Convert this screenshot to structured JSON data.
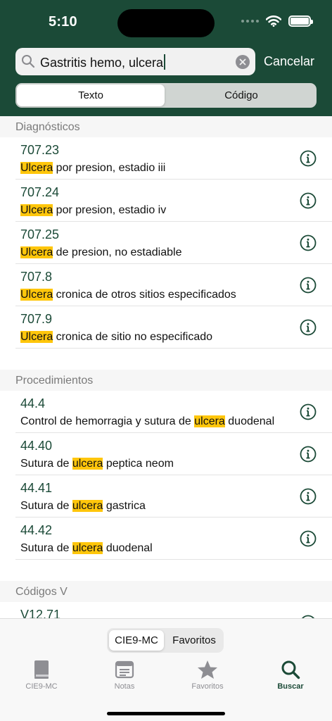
{
  "status": {
    "time": "5:10"
  },
  "search": {
    "query": "Gastritis hemo, ulcera",
    "cancel_label": "Cancelar"
  },
  "segment": {
    "options": [
      "Texto",
      "Código"
    ],
    "selected": "Texto"
  },
  "sections": [
    {
      "title": "Diagnósticos",
      "rows": [
        {
          "code": "707.23",
          "pre": "",
          "hl": "Ulcera",
          "post": " por presion, estadio iii"
        },
        {
          "code": "707.24",
          "pre": "",
          "hl": "Ulcera",
          "post": " por presion, estadio iv"
        },
        {
          "code": "707.25",
          "pre": "",
          "hl": "Ulcera",
          "post": " de presion, no estadiable"
        },
        {
          "code": "707.8",
          "pre": "",
          "hl": "Ulcera",
          "post": " cronica de otros sitios especificados"
        },
        {
          "code": "707.9",
          "pre": "",
          "hl": "Ulcera",
          "post": " cronica de sitio no especificado"
        }
      ]
    },
    {
      "title": "Procedimientos",
      "rows": [
        {
          "code": "44.4",
          "pre": "Control de hemorragia y sutura de ",
          "hl": "ulcera",
          "post": " duodenal"
        },
        {
          "code": "44.40",
          "pre": "Sutura de ",
          "hl": "ulcera",
          "post": " peptica neom"
        },
        {
          "code": "44.41",
          "pre": "Sutura de ",
          "hl": "ulcera",
          "post": " gastrica"
        },
        {
          "code": "44.42",
          "pre": "Sutura de ",
          "hl": "ulcera",
          "post": " duodenal"
        }
      ]
    },
    {
      "title": "Códigos V",
      "rows": [
        {
          "code": "V12.71",
          "pre": "",
          "hl": "",
          "post": ""
        }
      ]
    }
  ],
  "bottom_segment": {
    "options": [
      "CIE9-MC",
      "Favoritos"
    ],
    "selected": "CIE9-MC"
  },
  "tabs": [
    {
      "label": "CIE9-MC",
      "icon": "book-icon"
    },
    {
      "label": "Notas",
      "icon": "notes-icon"
    },
    {
      "label": "Favoritos",
      "icon": "star-icon"
    },
    {
      "label": "Buscar",
      "icon": "search-icon"
    }
  ],
  "active_tab": "Buscar",
  "colors": {
    "header": "#1b4a37",
    "highlight": "#ffc60b",
    "code": "#1b4a37"
  }
}
